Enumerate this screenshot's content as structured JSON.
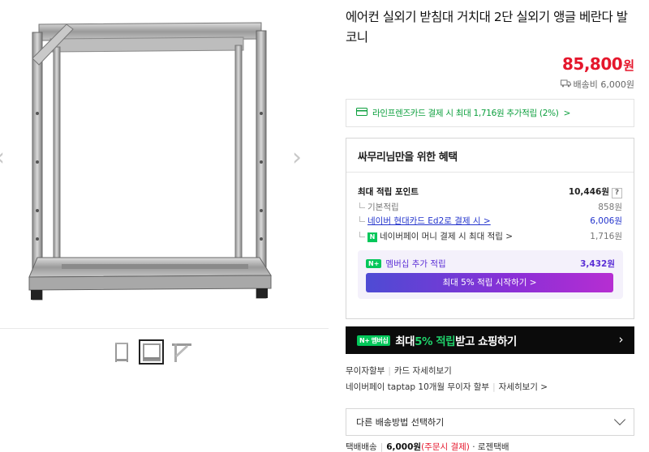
{
  "product": {
    "title": "에어컨 실외기 받침대 거치대 2단 실외기 앵글 베란다 발코니",
    "price": "85,800",
    "price_unit": "원",
    "shipping": "배송비 6,000원"
  },
  "card_banner": {
    "text": "라인프렌즈카드 결제 시 최대 1,716원 추가적립 (2%)",
    "arrow": ">"
  },
  "benefit": {
    "heading": "싸무리님만을 위한 혜택",
    "max_points_label": "최대 적립 포인트",
    "max_points_value": "10,446원",
    "help": "?",
    "rows": [
      {
        "label": "기본적립",
        "value": "858원"
      },
      {
        "label": "네이버 현대카드 Ed2로 결제 시 >",
        "value": "6,006원"
      },
      {
        "label": "네이버페이 머니 결제 시 최대 적립 >",
        "value": "1,716원"
      }
    ],
    "npay_mini": "N",
    "member_label": "멤버십 추가 적립",
    "member_badge": "N+",
    "member_value": "3,432원",
    "member_button": "최대 5% 적립 시작하기 >"
  },
  "promo": {
    "badge": "N+ 멤버십",
    "text_pre": "최대 ",
    "text_hl": "5% 적립",
    "text_post": " 받고 쇼핑하기",
    "arrow": "›"
  },
  "installment": {
    "line1_a": "무이자할부",
    "line1_b": "카드 자세히보기",
    "line2_a": "네이버페이 taptap 10개월 무이자 할부",
    "line2_b": "자세히보기 >"
  },
  "shipping_select": {
    "label": "다른 배송방법 선택하기"
  },
  "shipping_method": {
    "type": "택배배송",
    "cost": "6,000원",
    "note": "(주문시 결제)",
    "carrier": "· 로젠택배"
  },
  "gallery": {
    "prev": "‹",
    "next": "›"
  }
}
